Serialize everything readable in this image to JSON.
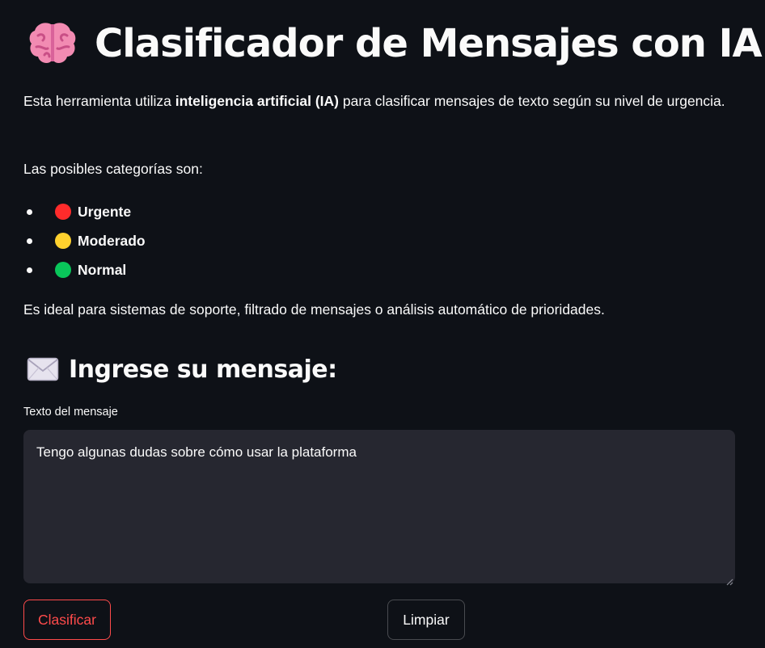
{
  "header": {
    "title": "Clasificador de Mensajes con IA",
    "icon": "brain-icon"
  },
  "intro": {
    "before": "Esta herramienta utiliza ",
    "bold": "inteligencia artificial (IA)",
    "after": " para clasificar mensajes de texto según su nivel de urgencia."
  },
  "categories_intro": "Las posibles categorías son:",
  "categories": [
    {
      "label": "Urgente",
      "color": "#ff2b2b"
    },
    {
      "label": "Moderado",
      "color": "#ffd12e"
    },
    {
      "label": "Normal",
      "color": "#09c65a"
    }
  ],
  "usage_text": "Es ideal para sistemas de soporte, filtrado de mensajes o análisis automático de prioridades.",
  "input_section": {
    "heading": "Ingrese su mensaje:",
    "icon": "envelope-icon",
    "field_label": "Texto del mensaje",
    "value": "Tengo algunas dudas sobre cómo usar la plataforma"
  },
  "buttons": {
    "classify": "Clasificar",
    "clear": "Limpiar"
  },
  "colors": {
    "background": "#0e1117",
    "input_background": "#262730",
    "primary": "#ff4b4b",
    "text": "#fafafa"
  }
}
